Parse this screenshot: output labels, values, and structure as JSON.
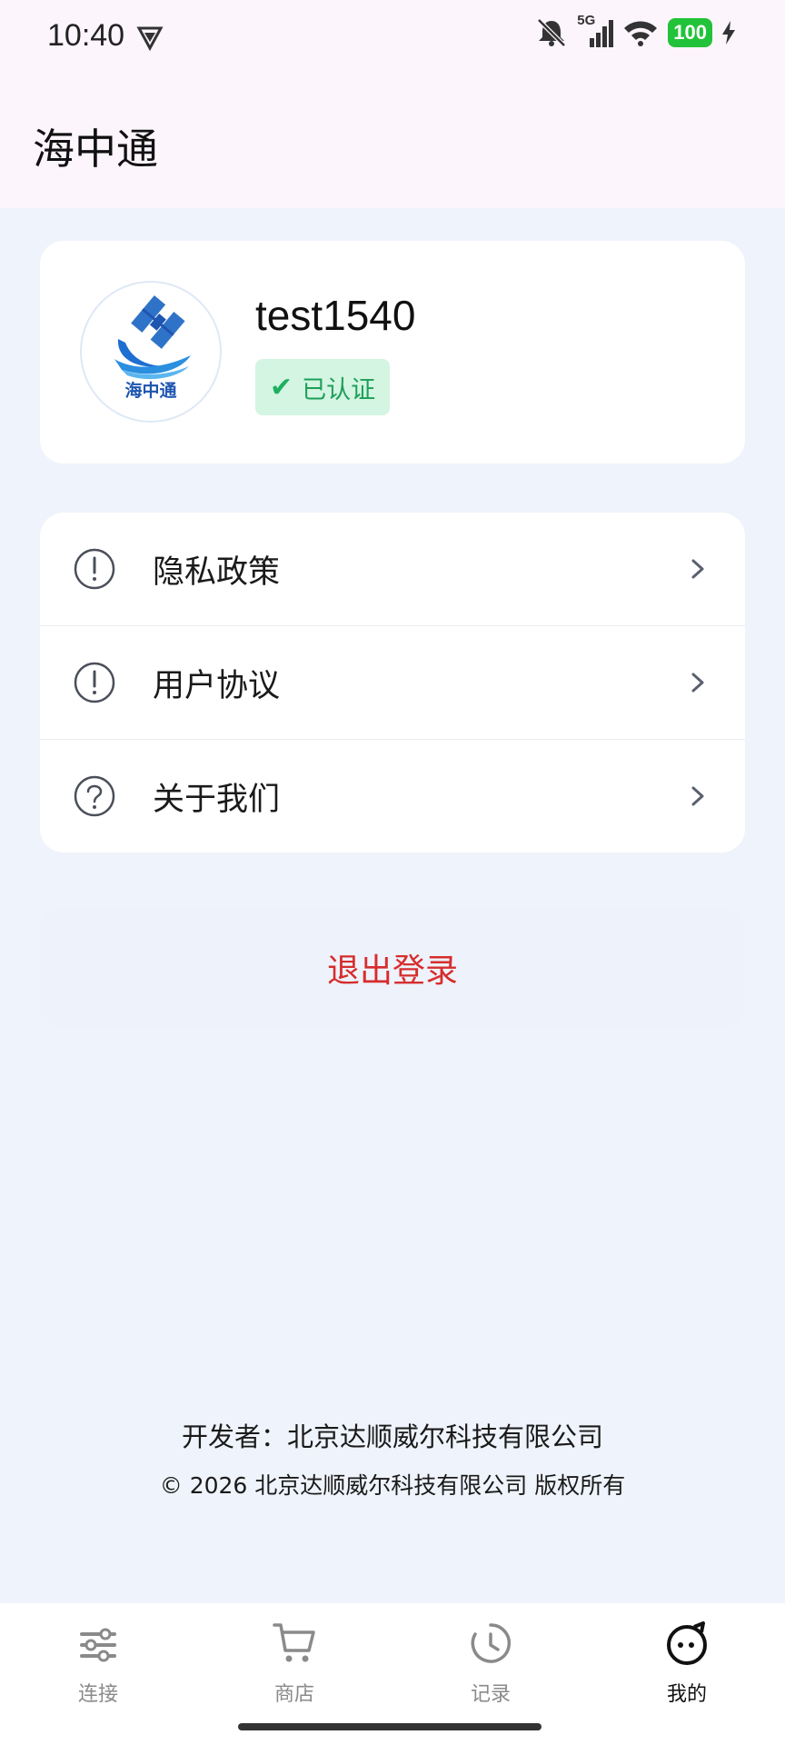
{
  "status_bar": {
    "time": "10:40",
    "network": "5G",
    "battery": "100",
    "icons": [
      "vpn-icon",
      "mute-icon",
      "signal-icon",
      "wifi-icon",
      "charging-icon"
    ]
  },
  "header": {
    "title": "海中通"
  },
  "profile": {
    "avatar_caption": "海中通",
    "username": "test1540",
    "verified_label": "已认证"
  },
  "menu": {
    "items": [
      {
        "label": "隐私政策",
        "icon": "info-icon"
      },
      {
        "label": "用户协议",
        "icon": "info-icon"
      },
      {
        "label": "关于我们",
        "icon": "help-icon"
      }
    ]
  },
  "logout_label": "退出登录",
  "footer": {
    "developer": "开发者：北京达顺威尔科技有限公司",
    "copyright": "© 2026 北京达顺威尔科技有限公司 版权所有"
  },
  "bottom_nav": {
    "items": [
      {
        "label": "连接",
        "icon": "connect-icon",
        "active": false
      },
      {
        "label": "商店",
        "icon": "cart-icon",
        "active": false
      },
      {
        "label": "记录",
        "icon": "history-icon",
        "active": false
      },
      {
        "label": "我的",
        "icon": "profile-face-icon",
        "active": true
      }
    ]
  },
  "colors": {
    "accent_red": "#d62d2d",
    "verified_green": "#1e9e5a",
    "header_bg": "#fcf5fc",
    "page_bg": "#eff3fb"
  }
}
